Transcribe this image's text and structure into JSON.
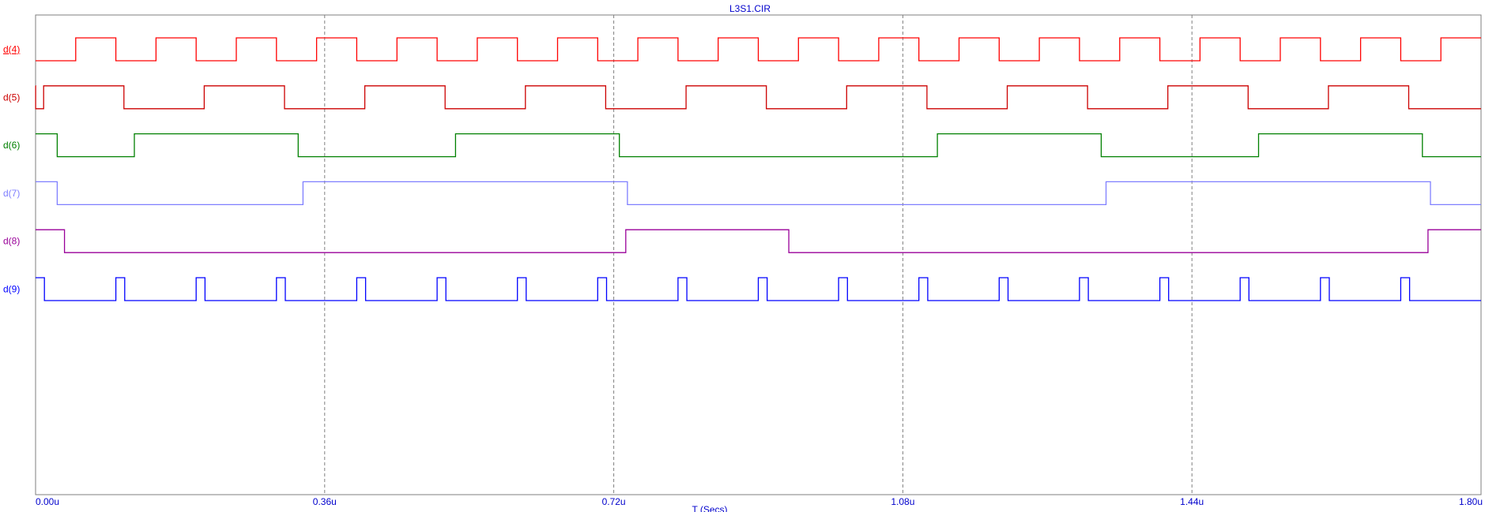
{
  "chart_data": {
    "type": "line",
    "title": "L3S1.CIR",
    "xlabel": "T (Secs)",
    "xlim": [
      0,
      1.8
    ],
    "x_unit": "u",
    "x_ticks": [
      "0.00u",
      "0.36u",
      "0.72u",
      "1.08u",
      "1.44u",
      "1.80u"
    ],
    "x_tick_values": [
      0,
      0.36,
      0.72,
      1.08,
      1.44,
      1.8
    ],
    "grid": "vertical-dashed",
    "series": [
      {
        "name": "d(4)",
        "color": "#ff0000",
        "start": 0,
        "transitions": [
          0.05,
          0.1,
          0.15,
          0.2,
          0.25,
          0.3,
          0.35,
          0.4,
          0.45,
          0.5,
          0.55,
          0.6,
          0.65,
          0.7,
          0.75,
          0.8,
          0.85,
          0.9,
          0.95,
          1.0,
          1.05,
          1.1,
          1.15,
          1.2,
          1.25,
          1.3,
          1.35,
          1.4,
          1.45,
          1.5,
          1.55,
          1.6,
          1.65,
          1.7,
          1.75
        ]
      },
      {
        "name": "d(5)",
        "color": "#cc0000",
        "start": 1,
        "transitions": [
          0.0001,
          0.01,
          0.11,
          0.21,
          0.31,
          0.41,
          0.51,
          0.61,
          0.71,
          0.81,
          0.91,
          1.01,
          1.11,
          1.21,
          1.31,
          1.41,
          1.51,
          1.61,
          1.71
        ]
      },
      {
        "name": "d(6)",
        "color": "#008000",
        "start": 1,
        "transitions": [
          0.027,
          0.123,
          0.327,
          0.523,
          0.727,
          1.123,
          1.327,
          1.523,
          1.727
        ]
      },
      {
        "name": "d(7)",
        "color": "#7f7fff",
        "start": 1,
        "transitions": [
          0.027,
          0.333,
          0.737,
          1.333,
          1.737
        ]
      },
      {
        "name": "d(8)",
        "color": "#990099",
        "start": 1,
        "transitions": [
          0.036,
          0.735,
          0.938,
          1.734
        ]
      },
      {
        "name": "d(9)",
        "color": "#0000ff",
        "start": 1,
        "transitions": [
          0.011,
          0.1,
          0.111,
          0.2,
          0.211,
          0.3,
          0.311,
          0.4,
          0.411,
          0.5,
          0.511,
          0.6,
          0.611,
          0.7,
          0.711,
          0.8,
          0.811,
          0.9,
          0.911,
          1.0,
          1.011,
          1.1,
          1.111,
          1.2,
          1.211,
          1.3,
          1.311,
          1.4,
          1.411,
          1.5,
          1.511,
          1.6,
          1.611,
          1.7,
          1.711
        ]
      }
    ]
  }
}
